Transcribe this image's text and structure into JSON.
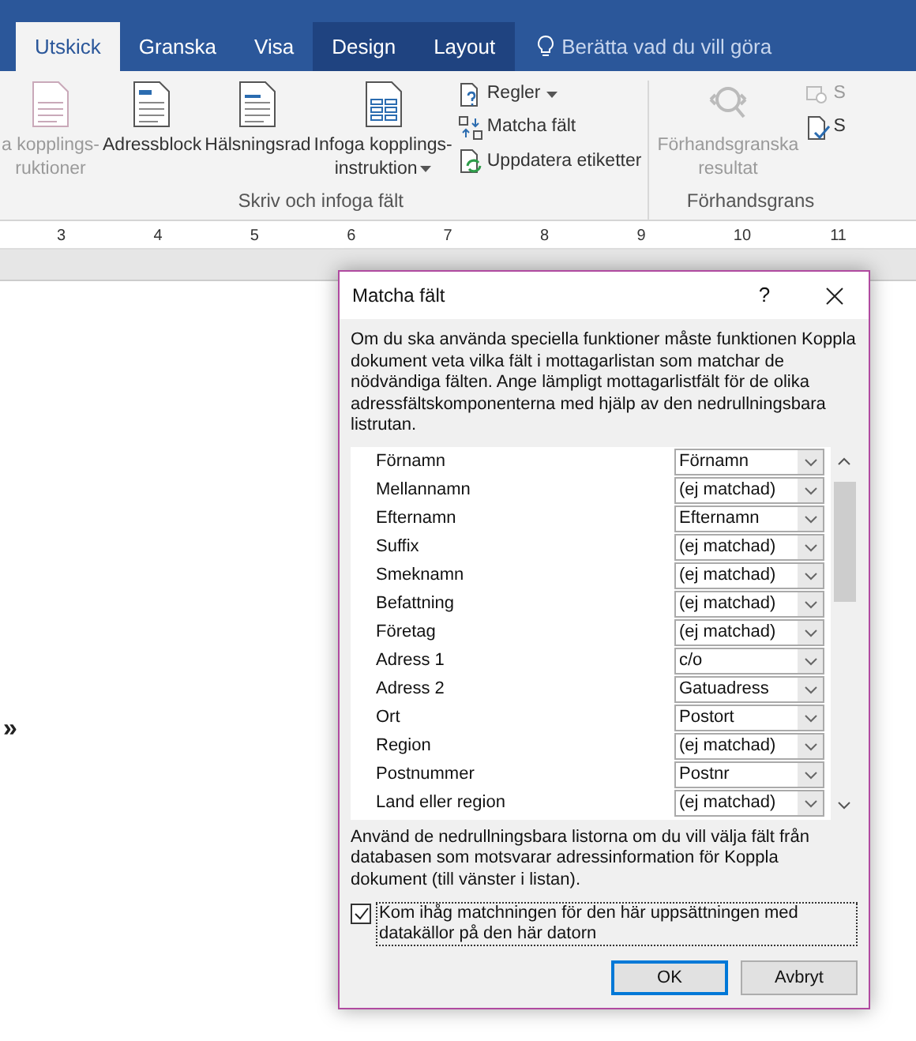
{
  "ribbon_tabs": [
    {
      "label": "Utskick",
      "selected": true,
      "kind": "normal"
    },
    {
      "label": "Granska",
      "selected": false,
      "kind": "normal"
    },
    {
      "label": "Visa",
      "selected": false,
      "kind": "normal"
    },
    {
      "label": "Design",
      "selected": false,
      "kind": "contextual"
    },
    {
      "label": "Layout",
      "selected": false,
      "kind": "contextual"
    }
  ],
  "tell_me": {
    "placeholder": "Berätta vad du vill göra"
  },
  "ribbon_groups": [
    {
      "label": "Skriv och infoga fält",
      "large_buttons": [
        {
          "lines": [
            "a kopplings-",
            "ruktioner"
          ],
          "kind": "doc",
          "disabled": true,
          "has_menu": false
        },
        {
          "lines": [
            "Adressblock"
          ],
          "kind": "address",
          "disabled": false,
          "has_menu": false
        },
        {
          "lines": [
            "Hälsningsrad"
          ],
          "kind": "greeting",
          "disabled": false,
          "has_menu": false
        },
        {
          "lines": [
            "Infoga kopplings-",
            "instruktion"
          ],
          "kind": "table",
          "disabled": false,
          "has_menu": true
        }
      ],
      "small_buttons": [
        {
          "label": "Regler",
          "kind": "rules",
          "disabled": false,
          "has_menu": true
        },
        {
          "label": "Matcha fält",
          "kind": "match",
          "disabled": false,
          "has_menu": false
        },
        {
          "label": "Uppdatera etiketter",
          "kind": "update",
          "disabled": false,
          "has_menu": false
        }
      ]
    },
    {
      "label": "Förhandsgrans",
      "large_buttons": [
        {
          "lines": [
            "Förhandsgranska",
            "resultat"
          ],
          "kind": "preview",
          "disabled": true,
          "has_menu": false
        }
      ],
      "small_buttons": [
        {
          "label": "S",
          "kind": "find",
          "disabled": true,
          "has_menu": false
        },
        {
          "label": "S",
          "kind": "check",
          "disabled": false,
          "has_menu": false
        }
      ]
    }
  ],
  "ruler": {
    "numbers": [
      "3",
      "4",
      "5",
      "6",
      "7",
      "8",
      "9",
      "10",
      "11"
    ]
  },
  "document": {
    "text": "»"
  },
  "dialog": {
    "title": "Matcha fält",
    "help": "?",
    "description": "Om du ska använda speciella funktioner måste funktionen Koppla dokument veta vilka fält i mottagarlistan som matchar de nödvändiga fälten. Ange lämpligt mottagarlistfält för de olika adressfältskomponenterna med hjälp av den nedrullningsbara listrutan.",
    "fields": [
      {
        "label": "Förnamn",
        "value": "Förnamn"
      },
      {
        "label": "Mellannamn",
        "value": "(ej matchad)"
      },
      {
        "label": "Efternamn",
        "value": "Efternamn"
      },
      {
        "label": "Suffix",
        "value": "(ej matchad)"
      },
      {
        "label": "Smeknamn",
        "value": "(ej matchad)"
      },
      {
        "label": "Befattning",
        "value": "(ej matchad)"
      },
      {
        "label": "Företag",
        "value": "(ej matchad)"
      },
      {
        "label": "Adress 1",
        "value": "c/o"
      },
      {
        "label": "Adress 2",
        "value": "Gatuadress"
      },
      {
        "label": "Ort",
        "value": "Postort"
      },
      {
        "label": "Region",
        "value": "(ej matchad)"
      },
      {
        "label": "Postnummer",
        "value": "Postnr"
      },
      {
        "label": "Land eller region",
        "value": "(ej matchad)"
      }
    ],
    "footer_text": "Använd de nedrullningsbara listorna om du vill välja fält från databasen som motsvarar adressinformation för Koppla dokument (till vänster i listan).",
    "remember": {
      "label": "Kom ihåg matchningen för den här uppsättningen med datakällor på den här datorn",
      "checked": true
    },
    "buttons": [
      {
        "label": "OK",
        "default": true
      },
      {
        "label": "Avbryt",
        "default": false
      }
    ]
  }
}
